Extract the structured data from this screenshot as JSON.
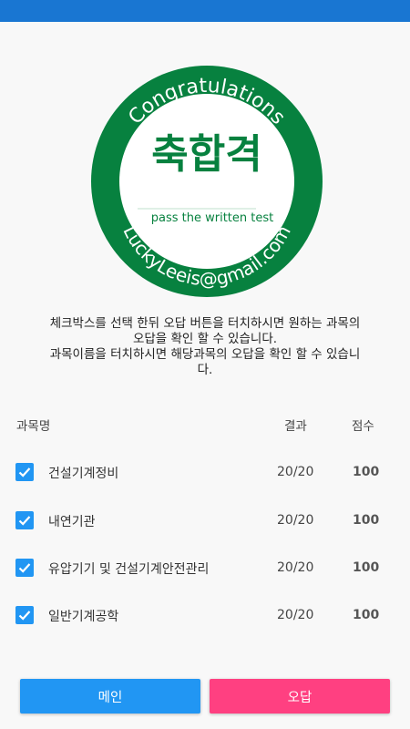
{
  "badge": {
    "top_text": "Congratulations",
    "center_text": "축합격",
    "sub_text": "pass the written test",
    "bottom_text": "LuckyLeeis@gmail.com",
    "ring_color": "#07813f"
  },
  "instructions": {
    "line1": "체크박스를 선택 한뒤 오답 버튼을 터치하시면 원하는 과목의",
    "line2": "오답을 확인 할 수 있습니다.",
    "line3": "과목이름을 터치하시면 해당과목의 오답을 확인 할 수 있습니",
    "line4": "다."
  },
  "table": {
    "headers": {
      "name": "과목명",
      "result": "결과",
      "score": "점수"
    },
    "rows": [
      {
        "name": "건설기계정비",
        "result": "20/20",
        "score": "100",
        "checked": true
      },
      {
        "name": "내연기관",
        "result": "20/20",
        "score": "100",
        "checked": true
      },
      {
        "name": "유압기기 및 건설기계안전관리",
        "result": "20/20",
        "score": "100",
        "checked": true
      },
      {
        "name": "일반기계공학",
        "result": "20/20",
        "score": "100",
        "checked": true
      }
    ]
  },
  "buttons": {
    "main_label": "메인",
    "wrong_label": "오답"
  },
  "colors": {
    "status_bar": "#1976d2",
    "accent_blue": "#2196f3",
    "accent_pink": "#ff4081"
  }
}
